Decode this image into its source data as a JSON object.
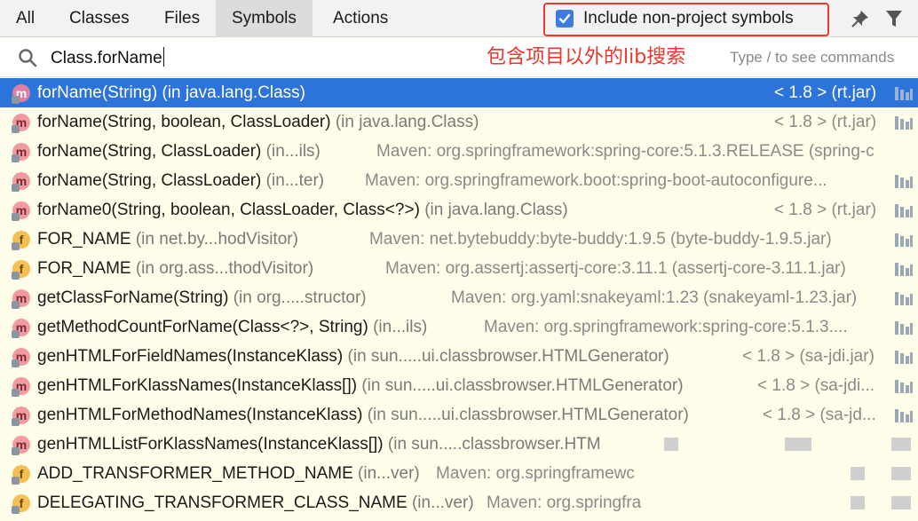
{
  "tabs": [
    {
      "label": "All"
    },
    {
      "label": "Classes"
    },
    {
      "label": "Files"
    },
    {
      "label": "Symbols"
    },
    {
      "label": "Actions"
    }
  ],
  "active_tab": "Symbols",
  "include_non_project": {
    "label": "Include non-project symbols",
    "checked": true
  },
  "search": {
    "value": "Class.forName",
    "hint": "Type / to see commands"
  },
  "annotation": "包含项目以外的lib搜索",
  "colors": {
    "accent": "#2d74da",
    "annotation": "#e8382d",
    "method_badge": "#f29a9f",
    "field_badge": "#f5bf52"
  },
  "results": [
    {
      "kind": "m",
      "name": "forName(String)",
      "context": "(in java.lang.Class)",
      "source": "< 1.8 > (rt.jar)"
    },
    {
      "kind": "m",
      "name": "forName(String, boolean, ClassLoader)",
      "context": "(in java.lang.Class)",
      "source": "< 1.8 > (rt.jar)"
    },
    {
      "kind": "m",
      "name": "forName(String, ClassLoader)",
      "context": "(in...ils)",
      "source": "Maven: org.springframework:spring-core:5.1.3.RELEASE (spring-c"
    },
    {
      "kind": "m",
      "name": "forName(String, ClassLoader)",
      "context": "(in...ter)",
      "source": "Maven: org.springframework.boot:spring-boot-autoconfigure..."
    },
    {
      "kind": "m",
      "name": "forName0(String, boolean, ClassLoader, Class<?>)",
      "context": "(in java.lang.Class)",
      "source": "< 1.8 > (rt.jar)"
    },
    {
      "kind": "f",
      "name": "FOR_NAME",
      "context": "(in net.by...hodVisitor)",
      "source": "Maven: net.bytebuddy:byte-buddy:1.9.5 (byte-buddy-1.9.5.jar)"
    },
    {
      "kind": "f",
      "name": "FOR_NAME",
      "context": "(in org.ass...thodVisitor)",
      "source": "Maven: org.assertj:assertj-core:3.11.1 (assertj-core-3.11.1.jar)"
    },
    {
      "kind": "m",
      "name": "getClassForName(String)",
      "context": "(in org.....structor)",
      "source": "Maven: org.yaml:snakeyaml:1.23 (snakeyaml-1.23.jar)"
    },
    {
      "kind": "m",
      "name": "getMethodCountForName(Class<?>, String)",
      "context": "(in...ils)",
      "source": "Maven: org.springframework:spring-core:5.1.3...."
    },
    {
      "kind": "m",
      "name": "genHTMLForFieldNames(InstanceKlass)",
      "context": "(in sun.....ui.classbrowser.HTMLGenerator)",
      "source": "< 1.8 > (sa-jdi.jar)"
    },
    {
      "kind": "m",
      "name": "genHTMLForKlassNames(InstanceKlass[])",
      "context": "(in sun.....ui.classbrowser.HTMLGenerator)",
      "source": "< 1.8 > (sa-jdi..."
    },
    {
      "kind": "m",
      "name": "genHTMLForMethodNames(InstanceKlass)",
      "context": "(in sun.....ui.classbrowser.HTMLGenerator)",
      "source": "< 1.8 > (sa-jd..."
    },
    {
      "kind": "m",
      "name": "genHTMLListForKlassNames(InstanceKlass[])",
      "context": "(in sun.....classbrowser.HTM",
      "source": ""
    },
    {
      "kind": "f",
      "name": "ADD_TRANSFORMER_METHOD_NAME",
      "context": "(in...ver)",
      "source": "Maven: org.springframewc"
    },
    {
      "kind": "f",
      "name": "DELEGATING_TRANSFORMER_CLASS_NAME",
      "context": "(in...ver)",
      "source": "Maven: org.springfra"
    }
  ]
}
